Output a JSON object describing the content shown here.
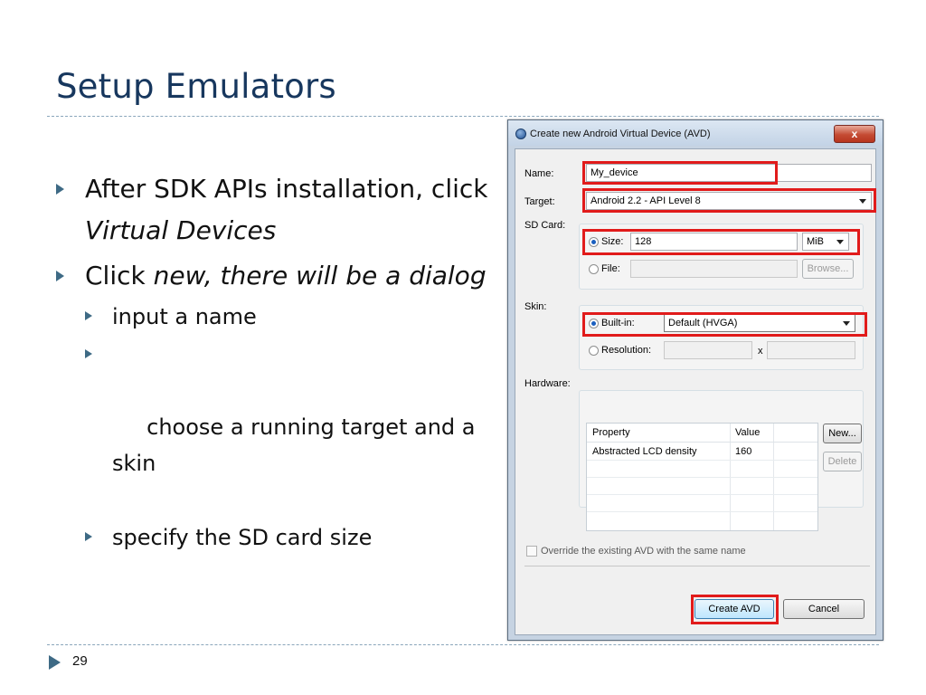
{
  "slide": {
    "title": "Setup Emulators",
    "page_number": "29",
    "bullets": [
      {
        "pre": "After SDK APIs installation, click ",
        "em": "Virtual Devices",
        "post": ""
      },
      {
        "pre": "Click ",
        "em": "new, there will be a dialog",
        "post": ""
      }
    ],
    "sub_bullets": [
      "input a name",
      " choose a running target and a skin",
      "specify the SD card size"
    ]
  },
  "dialog": {
    "title": "Create new Android Virtual Device (AVD)",
    "close_label": "x",
    "name_label": "Name:",
    "name_value": "My_device",
    "target_label": "Target:",
    "target_value": "Android 2.2 - API Level 8",
    "sdcard_label": "SD Card:",
    "size_label": "Size:",
    "size_value": "128",
    "size_unit": "MiB",
    "file_label": "File:",
    "browse_label": "Browse...",
    "skin_label": "Skin:",
    "builtin_label": "Built-in:",
    "builtin_value": "Default (HVGA)",
    "resolution_label": "Resolution:",
    "resolution_x": "x",
    "hardware_label": "Hardware:",
    "table_headers": [
      "Property",
      "Value"
    ],
    "table_rows": [
      {
        "property": "Abstracted LCD density",
        "value": "160"
      }
    ],
    "new_label": "New...",
    "delete_label": "Delete",
    "override_label": "Override the existing AVD with the same name",
    "create_label": "Create AVD",
    "cancel_label": "Cancel"
  },
  "colors": {
    "title": "#17375E",
    "highlight": "#e11b1b",
    "bullet_arrow": "#3e6a85"
  }
}
